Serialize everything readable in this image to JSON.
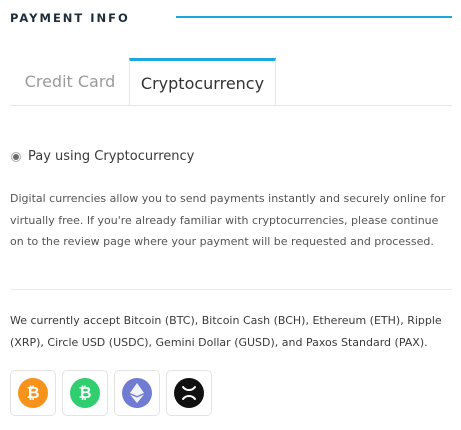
{
  "section": {
    "title": "PAYMENT INFO"
  },
  "tabs": [
    {
      "label": "Credit Card",
      "active": false
    },
    {
      "label": "Cryptocurrency",
      "active": true
    }
  ],
  "payment_option": {
    "label": "Pay using Cryptocurrency",
    "selected": true
  },
  "description": "Digital currencies allow you to send payments instantly and securely online for virtually free. If you're already familiar with cryptocurrencies, please continue on to the review page where your payment will be requested and processed.",
  "accepted_text": "We currently accept Bitcoin (BTC), Bitcoin Cash (BCH), Ethereum (ETH), Ripple (XRP), Circle USD (USDC), Gemini Dollar (GUSD), and Paxos Standard (PAX).",
  "coins": [
    {
      "name": "bitcoin-icon",
      "color": "#f7931a",
      "glyph": "₿"
    },
    {
      "name": "bitcoin-cash-icon",
      "color": "#2fcf6f",
      "glyph": "₿"
    },
    {
      "name": "ethereum-icon",
      "color": "#6f7cd1",
      "glyph": ""
    },
    {
      "name": "ripple-icon",
      "color": "#111111",
      "glyph": ""
    }
  ],
  "colors": {
    "accent": "#1ea7db"
  }
}
